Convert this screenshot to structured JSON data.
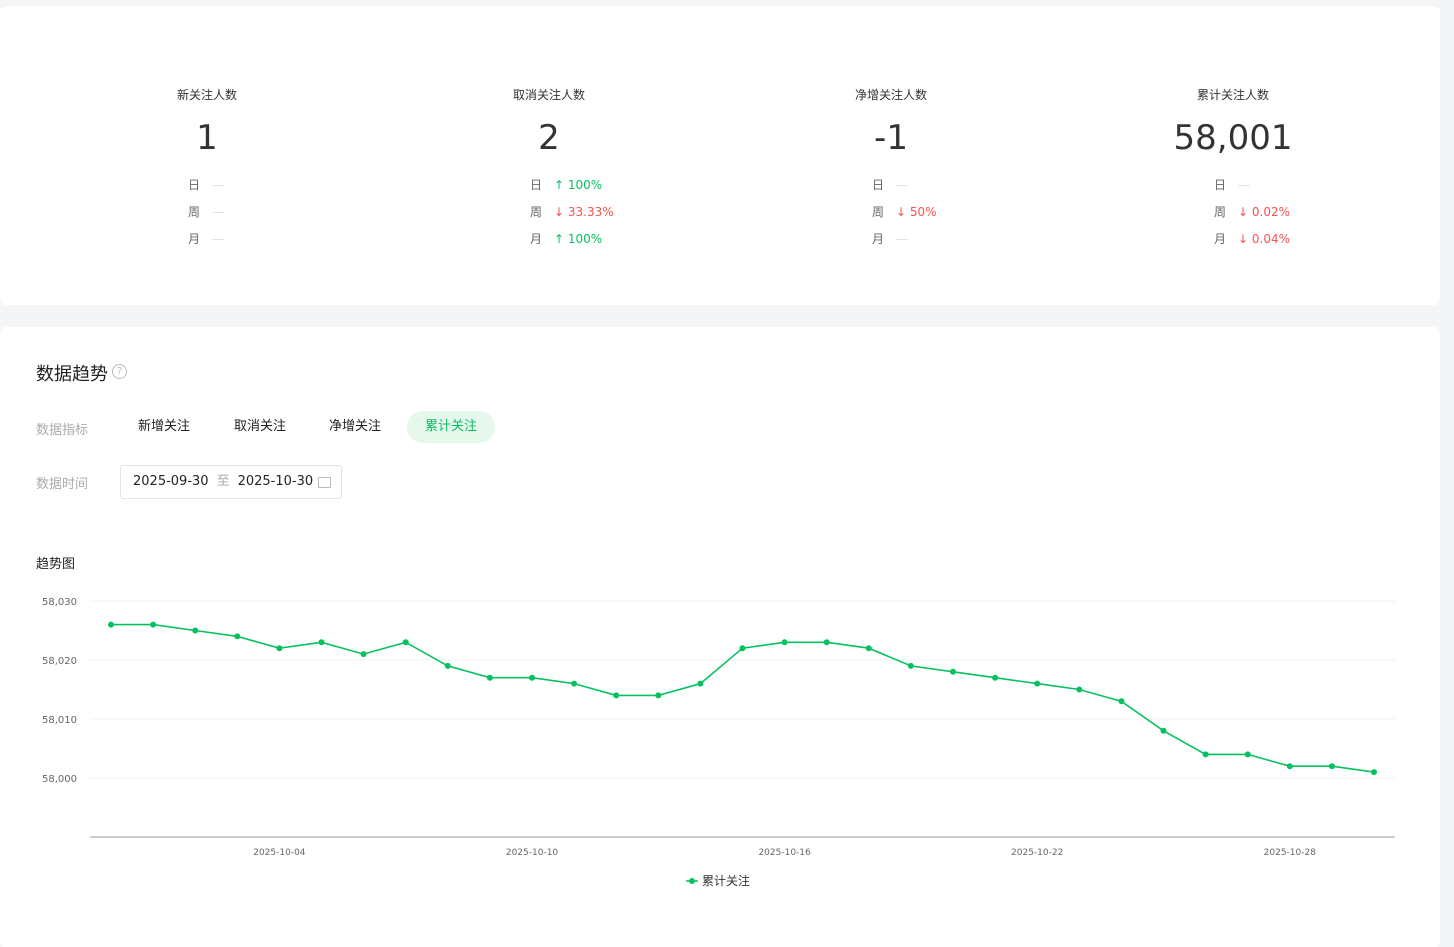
{
  "stats": [
    {
      "label": "新关注人数",
      "value": "1",
      "rows": [
        {
          "k": "日",
          "v": "—",
          "dir": "none"
        },
        {
          "k": "周",
          "v": "—",
          "dir": "none"
        },
        {
          "k": "月",
          "v": "—",
          "dir": "none"
        }
      ]
    },
    {
      "label": "取消关注人数",
      "value": "2",
      "rows": [
        {
          "k": "日",
          "v": "↑ 100%",
          "dir": "up"
        },
        {
          "k": "周",
          "v": "↓ 33.33%",
          "dir": "down"
        },
        {
          "k": "月",
          "v": "↑ 100%",
          "dir": "up"
        }
      ]
    },
    {
      "label": "净增关注人数",
      "value": "-1",
      "rows": [
        {
          "k": "日",
          "v": "—",
          "dir": "none"
        },
        {
          "k": "周",
          "v": "↓ 50%",
          "dir": "down"
        },
        {
          "k": "月",
          "v": "—",
          "dir": "none"
        }
      ]
    },
    {
      "label": "累计关注人数",
      "value": "58,001",
      "rows": [
        {
          "k": "日",
          "v": "—",
          "dir": "none"
        },
        {
          "k": "周",
          "v": "↓ 0.02%",
          "dir": "down"
        },
        {
          "k": "月",
          "v": "↓ 0.04%",
          "dir": "down"
        }
      ]
    }
  ],
  "trend": {
    "title": "数据趋势",
    "help_icon": "?",
    "metric_label": "数据指标",
    "metrics": [
      "新增关注",
      "取消关注",
      "净增关注",
      "累计关注"
    ],
    "active_metric": 3,
    "time_label": "数据时间",
    "date_start": "2025-09-30",
    "date_sep": "至",
    "date_end": "2025-10-30",
    "chart_title": "趋势图"
  },
  "chart_data": {
    "type": "line",
    "title": "趋势图",
    "ylim": [
      57990,
      58030
    ],
    "yticks": [
      58000,
      58010,
      58020,
      58030
    ],
    "ytick_labels": [
      "58,000",
      "58,010",
      "58,020",
      "58,030"
    ],
    "x": [
      "2025-09-30",
      "2025-10-01",
      "2025-10-02",
      "2025-10-03",
      "2025-10-04",
      "2025-10-05",
      "2025-10-06",
      "2025-10-07",
      "2025-10-08",
      "2025-10-09",
      "2025-10-10",
      "2025-10-11",
      "2025-10-12",
      "2025-10-13",
      "2025-10-14",
      "2025-10-15",
      "2025-10-16",
      "2025-10-17",
      "2025-10-18",
      "2025-10-19",
      "2025-10-20",
      "2025-10-21",
      "2025-10-22",
      "2025-10-23",
      "2025-10-24",
      "2025-10-25",
      "2025-10-26",
      "2025-10-27",
      "2025-10-28",
      "2025-10-29",
      "2025-10-30"
    ],
    "xtick_labels": [
      "2025-10-04",
      "2025-10-10",
      "2025-10-16",
      "2025-10-22",
      "2025-10-28"
    ],
    "series": [
      {
        "name": "累计关注",
        "color": "#07c160",
        "values": [
          58026,
          58026,
          58025,
          58024,
          58022,
          58023,
          58021,
          58023,
          58019,
          58017,
          58017,
          58016,
          58014,
          58014,
          58016,
          58022,
          58023,
          58023,
          58022,
          58019,
          58018,
          58017,
          58016,
          58015,
          58013,
          58008,
          58004,
          58004,
          58002,
          58002,
          58001
        ]
      }
    ],
    "legend": "bottom-center",
    "grid": true
  }
}
